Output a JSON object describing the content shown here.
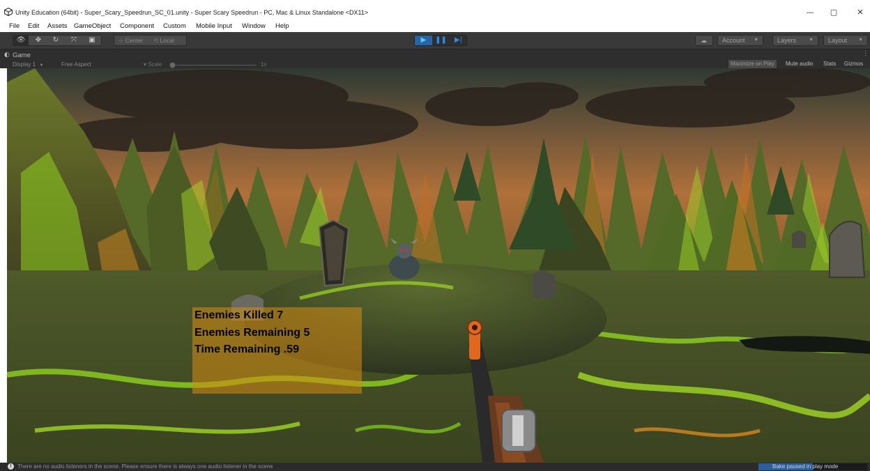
{
  "window": {
    "title": "Unity Education (64bit) - Super_Scary_Speedrun_SC_01.unity - Super Scary Speedrun - PC, Mac & Linux Standalone <DX11>",
    "minimize_glyph": "—",
    "maximize_glyph": "▢",
    "close_glyph": "✕"
  },
  "menu": [
    "File",
    "Edit",
    "Assets",
    "GameObject",
    "Component",
    "Custom",
    "Mobile Input",
    "Window",
    "Help"
  ],
  "toolbar": {
    "transform_tools": [
      {
        "name": "view-tool",
        "glyph": "👁"
      },
      {
        "name": "move-tool",
        "glyph": "✥"
      },
      {
        "name": "rotate-tool",
        "glyph": "↻"
      },
      {
        "name": "scale-tool",
        "glyph": "⤧"
      },
      {
        "name": "rect-tool",
        "glyph": "▣"
      }
    ],
    "pivot_label": "Center",
    "rotation_label": "Local",
    "play_glyph": "▶",
    "pause_glyph": "❚❚",
    "step_glyph": "▶|",
    "cloud_glyph": "☁",
    "account_label": "Account",
    "layers_label": "Layers",
    "layout_label": "Layout"
  },
  "game_view": {
    "tab_label": "Game",
    "display_label": "Display 1",
    "aspect_label": "Free Aspect",
    "scale_label": "Scale",
    "scale_value": "1x",
    "maximize_on_play": "Maximize on Play",
    "mute_audio": "Mute audio",
    "stats": "Stats",
    "gizmos": "Gizmos"
  },
  "hud": {
    "enemies_killed": "Enemies Killed 7",
    "enemies_remaining": "Enemies Remaining 5",
    "time_remaining": "Time Remaining .59"
  },
  "status": {
    "message": "There are no audio listeners in the scene. Please ensure there is always one audio listener in the scene",
    "bake_label": "Bake paused in play mode",
    "bake_progress": 0.5
  },
  "colors": {
    "editor_dark": "#393939",
    "hud_fill": "#d68c12",
    "play_active": "#2466a6",
    "lava_green": "#7cd61c",
    "lava_orange": "#e07a1c"
  }
}
